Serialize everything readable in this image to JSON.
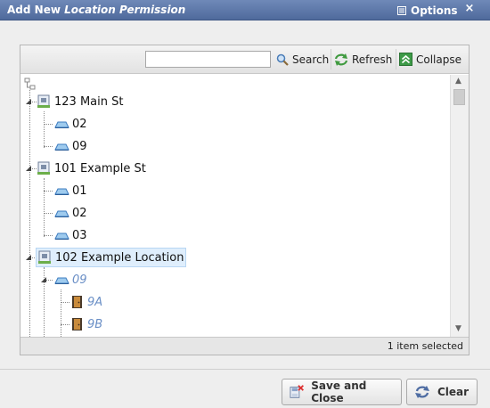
{
  "window": {
    "title_prefix": "Add New ",
    "title_italic": "Location Permission",
    "options_label": "Options",
    "close_glyph": "×"
  },
  "toolbar": {
    "search_value": "",
    "search_label": "Search",
    "refresh_label": "Refresh",
    "collapse_label": "Collapse"
  },
  "tree": {
    "nodes": [
      {
        "label": "123 Main St",
        "icon": "building-icon"
      },
      {
        "label": "02",
        "icon": "floor-icon"
      },
      {
        "label": "09",
        "icon": "floor-icon"
      },
      {
        "label": "101 Example St",
        "icon": "building-icon"
      },
      {
        "label": "01",
        "icon": "floor-icon"
      },
      {
        "label": "02",
        "icon": "floor-icon"
      },
      {
        "label": "03",
        "icon": "floor-icon"
      },
      {
        "label": "102 Example Location",
        "icon": "building-icon",
        "selected": true
      },
      {
        "label": "09",
        "icon": "floor-icon",
        "virtual": true
      },
      {
        "label": "9A",
        "icon": "door-icon",
        "virtual": true
      },
      {
        "label": "9B",
        "icon": "door-icon",
        "virtual": true
      }
    ]
  },
  "status": {
    "text": "1 item selected"
  },
  "footer": {
    "save_label": "Save and Close",
    "clear_label": "Clear"
  }
}
